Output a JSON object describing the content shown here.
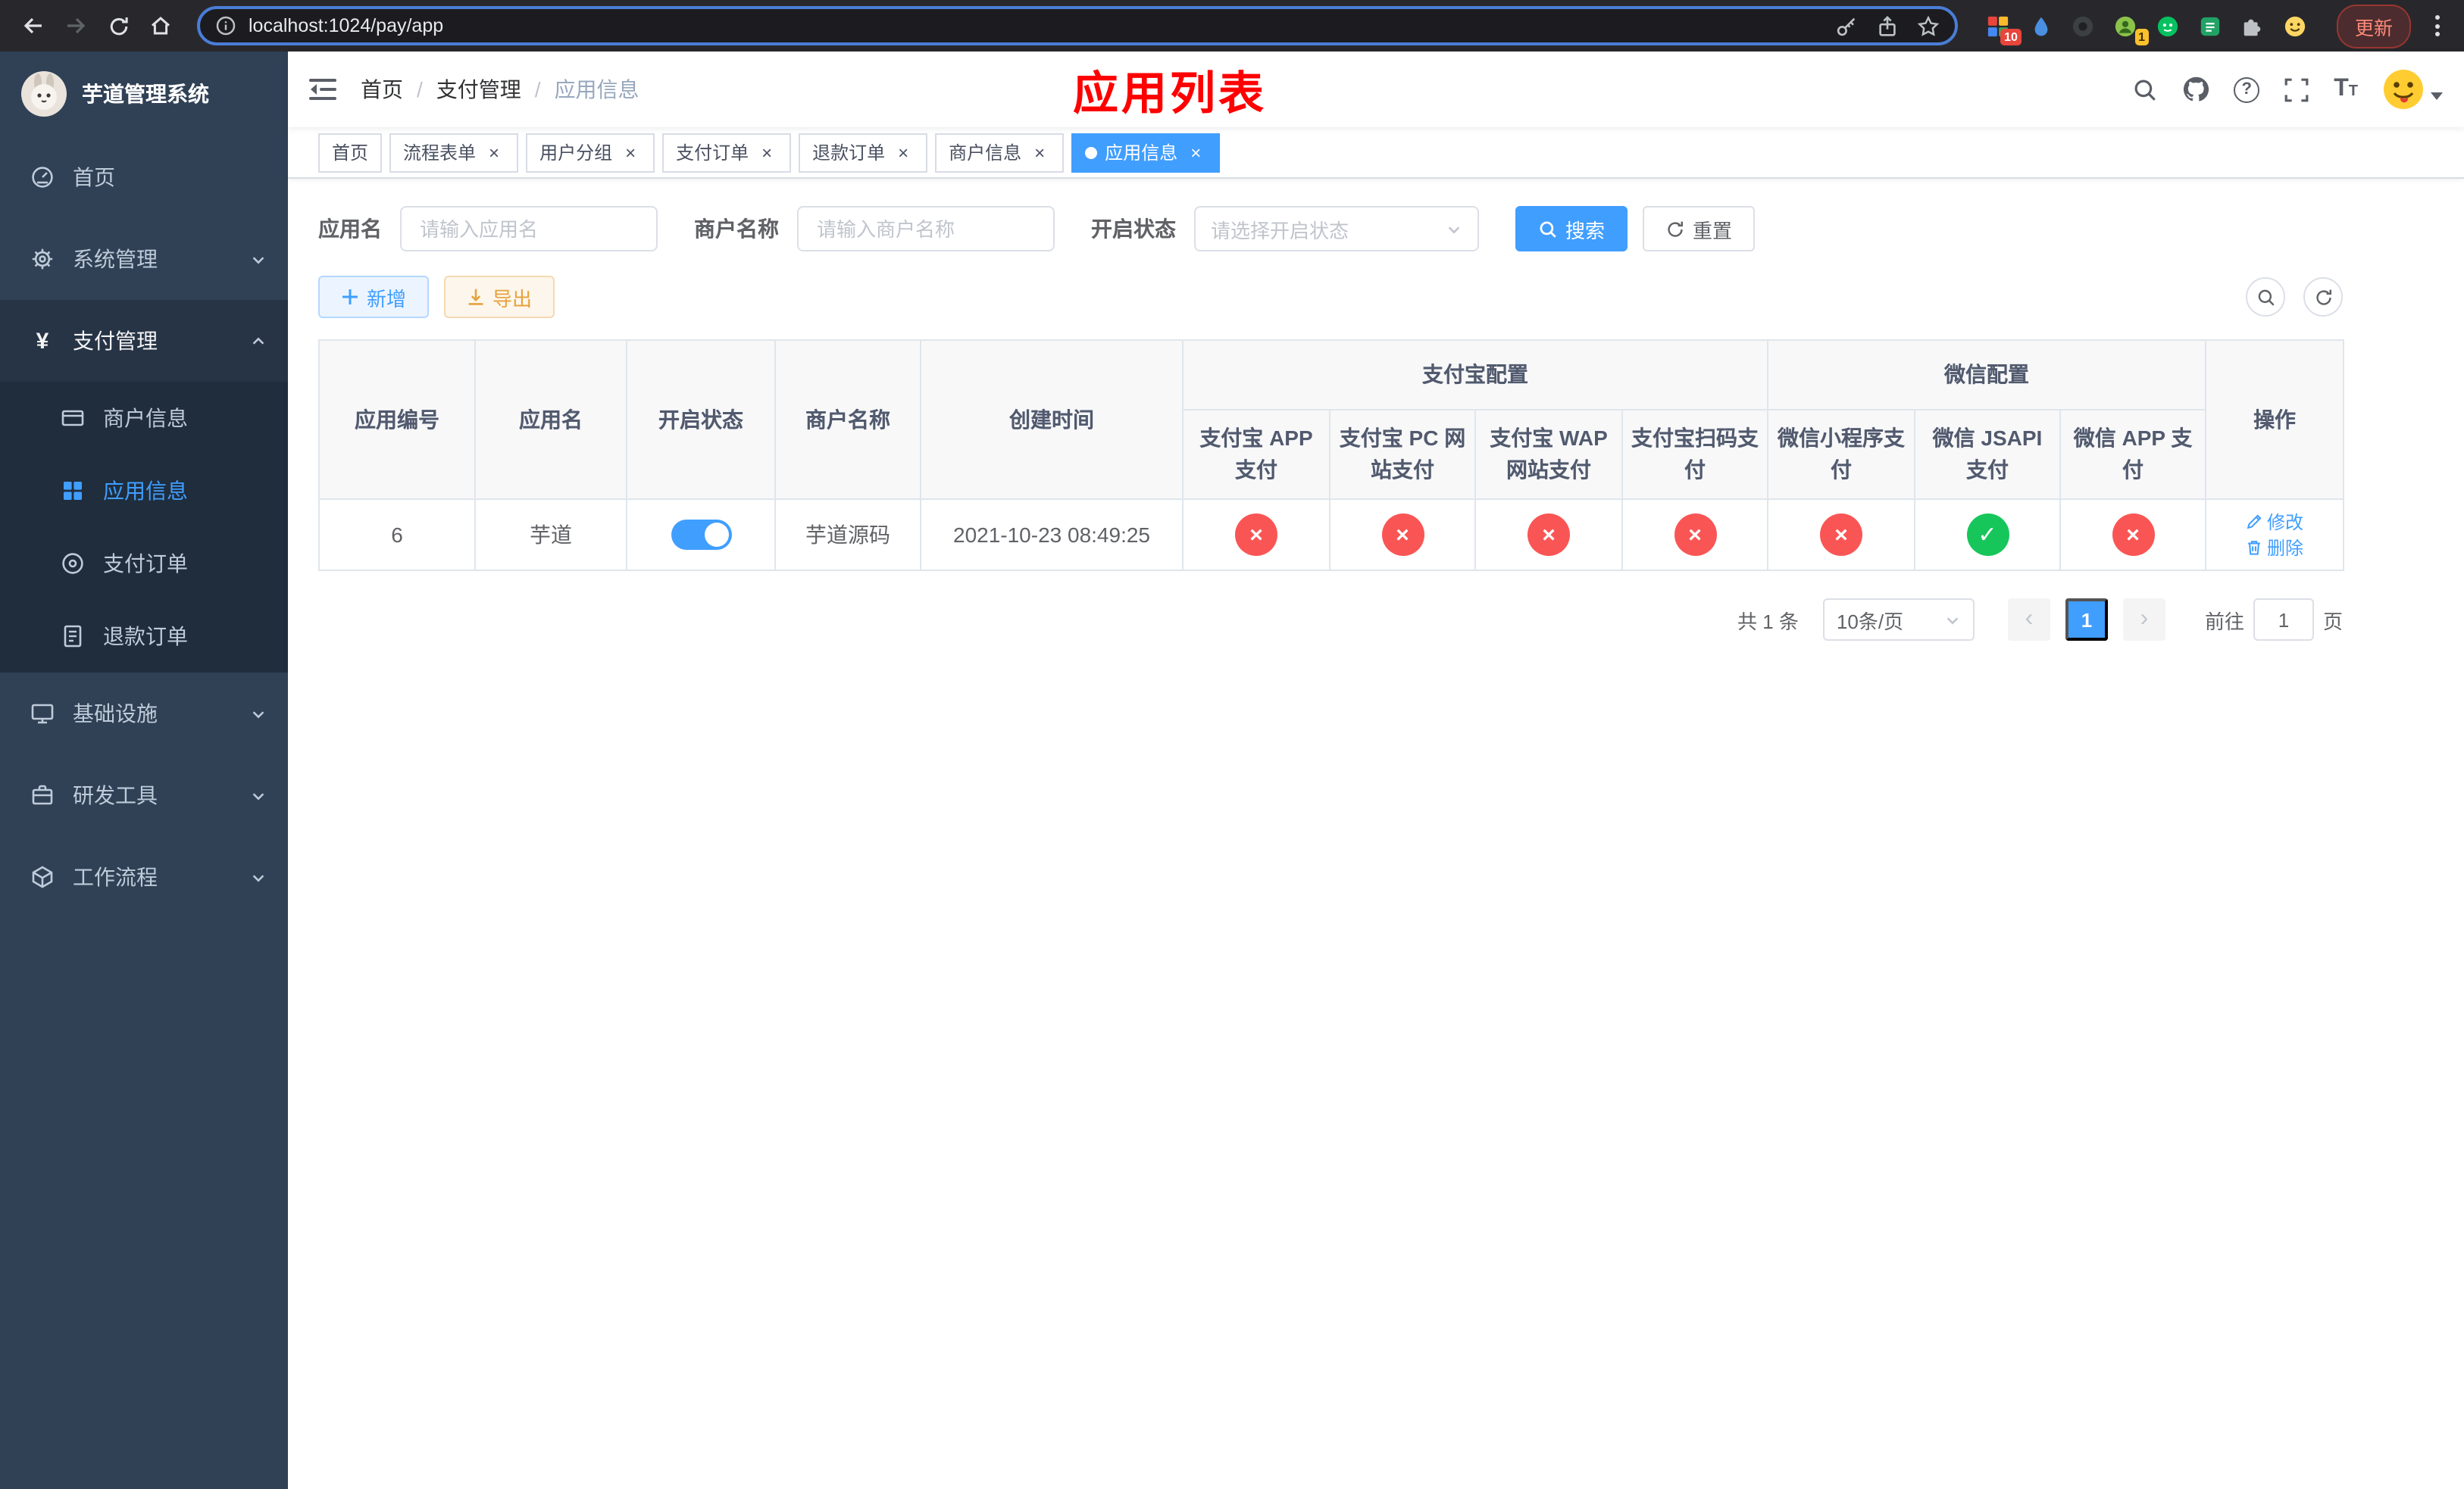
{
  "colors": {
    "accent": "#409eff",
    "danger": "#fa5555",
    "success": "#17c65b",
    "annotation": "#ff0000",
    "sidebar_bg": "#304156",
    "submenu_bg": "#1f2d3d"
  },
  "browser": {
    "url": "localhost:1024/pay/app",
    "update_label": "更新",
    "extensions_badge_count": "10",
    "translate_badge_count": "1"
  },
  "sidebar": {
    "title": "芋道管理系统",
    "items": {
      "home": "首页",
      "system": "系统管理",
      "payment": "支付管理",
      "merchant_info": "商户信息",
      "app_info": "应用信息",
      "pay_order": "支付订单",
      "refund_order": "退款订单",
      "infra": "基础设施",
      "dev_tools": "研发工具",
      "workflow": "工作流程"
    }
  },
  "navbar": {
    "breadcrumb": [
      "首页",
      "支付管理",
      "应用信息"
    ],
    "annotation": "应用列表"
  },
  "tabs": [
    {
      "label": "首页"
    },
    {
      "label": "流程表单"
    },
    {
      "label": "用户分组"
    },
    {
      "label": "支付订单"
    },
    {
      "label": "退款订单"
    },
    {
      "label": "商户信息"
    },
    {
      "label": "应用信息"
    }
  ],
  "filters": {
    "app_name_label": "应用名",
    "app_name_placeholder": "请输入应用名",
    "merchant_label": "商户名称",
    "merchant_placeholder": "请输入商户名称",
    "status_label": "开启状态",
    "status_placeholder": "请选择开启状态",
    "search_label": "搜索",
    "reset_label": "重置"
  },
  "toolbar": {
    "add_label": "新增",
    "export_label": "导出"
  },
  "table": {
    "columns": {
      "app_id": "应用编号",
      "app_name": "应用名",
      "status": "开启状态",
      "merchant": "商户名称",
      "create_time": "创建时间",
      "alipay_group": "支付宝配置",
      "wechat_group": "微信配置",
      "actions": "操作",
      "alipay_app": "支付宝 APP 支付",
      "alipay_pc": "支付宝 PC 网站支付",
      "alipay_wap": "支付宝 WAP 网站支付",
      "alipay_qr": "支付宝扫码支付",
      "wx_mini": "微信小程序支付",
      "wx_jsapi": "微信 JSAPI 支付",
      "wx_app": "微信 APP 支付"
    },
    "rows": [
      {
        "app_id": "6",
        "app_name": "芋道",
        "status_on": true,
        "merchant": "芋道源码",
        "create_time": "2021-10-23 08:49:25",
        "configs": [
          "fail",
          "fail",
          "fail",
          "fail",
          "fail",
          "ok",
          "fail"
        ],
        "edit_label": "修改",
        "delete_label": "删除"
      }
    ]
  },
  "pagination": {
    "total_label": "共 1 条",
    "page_size": "10条/页",
    "current_page": "1",
    "goto_prefix": "前往",
    "goto_value": "1",
    "goto_suffix": "页"
  }
}
